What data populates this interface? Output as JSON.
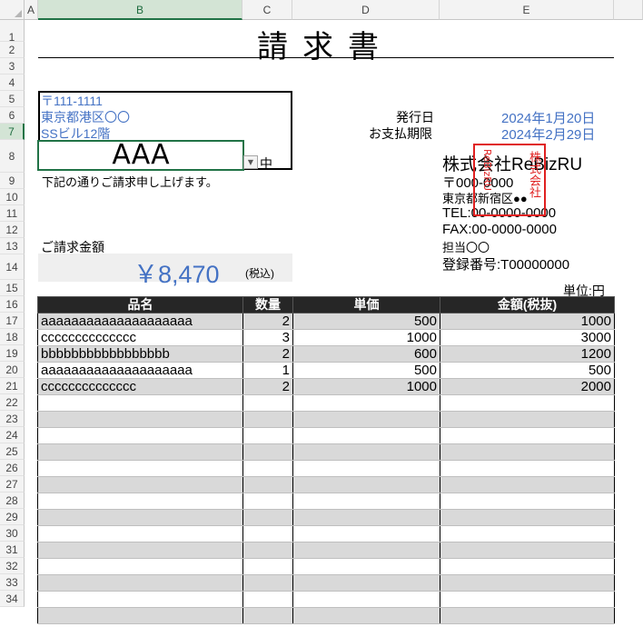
{
  "sheet": {
    "columns": [
      "A",
      "B",
      "C",
      "D",
      "E"
    ],
    "selected_column": "B",
    "rows": [
      "1",
      "2",
      "3",
      "4",
      "5",
      "6",
      "7",
      "8",
      "9",
      "10",
      "11",
      "12",
      "13",
      "14",
      "15",
      "16",
      "17",
      "18",
      "19",
      "20",
      "21",
      "22",
      "23",
      "24",
      "25",
      "26",
      "27",
      "28",
      "29",
      "30",
      "31",
      "32",
      "33",
      "34"
    ],
    "selected_row": "7"
  },
  "invoice": {
    "title": "請求書",
    "recipient": {
      "postal": "〒111-1111",
      "address1": "東京都港区〇〇",
      "address2": "SSビル12階",
      "name": "AAA",
      "honorific": "中"
    },
    "note": "下記の通りご請求申し上げます。",
    "issue_label": "発行日",
    "issue_date": "2024年1月20日",
    "due_label": "お支払期限",
    "due_date": "2024年2月29日",
    "company": {
      "name": "株式会社ReBizRU",
      "postal": "〒000-0000",
      "address": "東京都新宿区●●",
      "tel": "TEL:00-0000-0000",
      "fax": "FAX:00-0000-0000",
      "contact": "担当〇〇",
      "reg_no": "登録番号:T00000000"
    },
    "stamp": {
      "line1": "株式会社",
      "line2": "ReBizRU"
    },
    "amount_label": "ご請求金額",
    "amount": "￥8,470",
    "amount_suffix": "(税込)",
    "unit_label": "単位:円",
    "table_headers": [
      "品名",
      "数量",
      "単価",
      "金額(税抜)"
    ],
    "items": [
      {
        "name": "aaaaaaaaaaaaaaaaaaaa",
        "qty": "2",
        "price": "500",
        "amount": "1000"
      },
      {
        "name": "cccccccccccccc",
        "qty": "3",
        "price": "1000",
        "amount": "3000"
      },
      {
        "name": "bbbbbbbbbbbbbbbbb",
        "qty": "2",
        "price": "600",
        "amount": "1200"
      },
      {
        "name": "aaaaaaaaaaaaaaaaaaaa",
        "qty": "1",
        "price": "500",
        "amount": "500"
      },
      {
        "name": "cccccccccccccc",
        "qty": "2",
        "price": "1000",
        "amount": "2000"
      }
    ],
    "empty_rows": 14
  },
  "colors": {
    "accent_blue": "#4472c4",
    "header_dark": "#262626",
    "stripe_gray": "#d9d9d9",
    "stamp_red": "#e02020",
    "selection_green": "#217346"
  }
}
